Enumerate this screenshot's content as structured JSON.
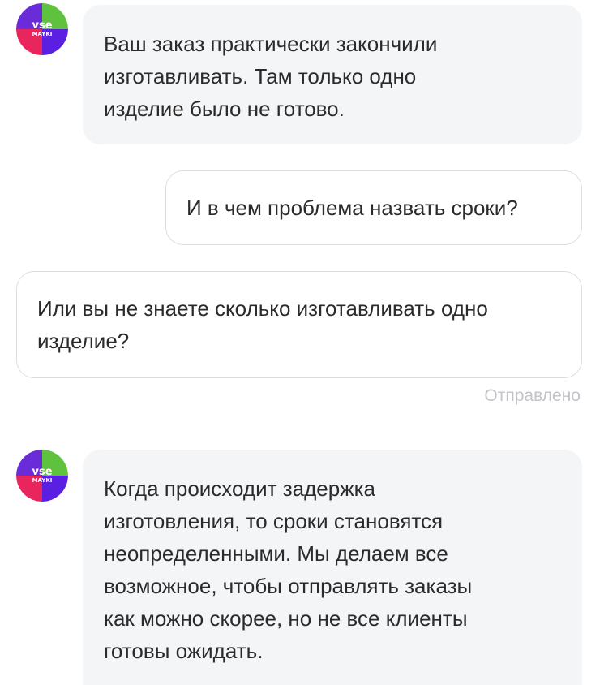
{
  "chat": {
    "avatar_label_top": "vse",
    "avatar_label_bottom": "MAYKI",
    "messages": [
      {
        "direction": "incoming",
        "text": "Ваш заказ практически закончили\nизготавливать. Там только одно\nизделие было не готово."
      },
      {
        "direction": "outgoing",
        "text": "И в чем проблема назвать сроки?"
      },
      {
        "direction": "outgoing",
        "text": "Или вы не знаете сколько изготавливать одно\nизделие?"
      },
      {
        "direction": "incoming",
        "text": "Когда происходит задержка\nизготовления, то сроки становятся\nнеопределенными. Мы делаем все\nвозможное, чтобы отправлять заказы\nкак можно скорее, но не все клиенты\nготовы ожидать."
      }
    ],
    "sent_status": "Отправлено"
  },
  "colors": {
    "incoming_bubble": "#f4f5f7",
    "outgoing_border": "#dcdde1",
    "status_text": "#c2c3c8",
    "avatar_green": "#5fc23f",
    "avatar_purple": "#5a1fe0",
    "avatar_pink": "#e8255d"
  },
  "icons": {
    "avatar": "vse-mayki-logo-icon"
  }
}
